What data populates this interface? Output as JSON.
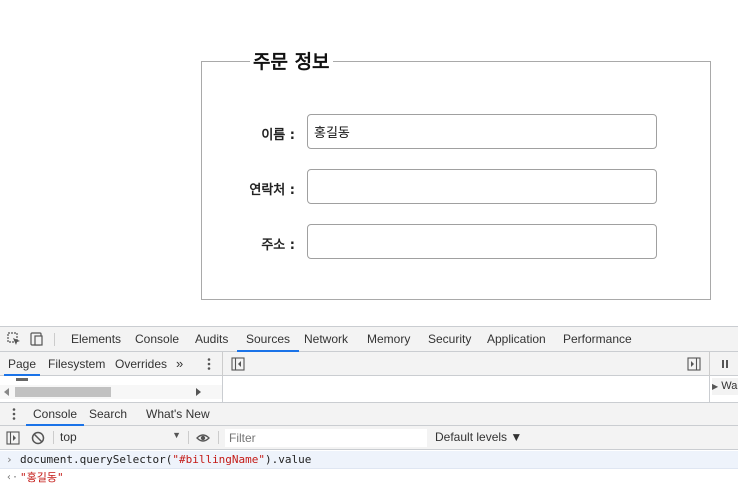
{
  "form": {
    "legend": "주문 정보",
    "fields": [
      {
        "label": "이름 :",
        "value": "홍길동",
        "id": "billingName"
      },
      {
        "label": "연락처 :",
        "value": ""
      },
      {
        "label": "주소 :",
        "value": ""
      }
    ]
  },
  "devtools": {
    "tabs": [
      "Elements",
      "Console",
      "Audits",
      "Sources",
      "Network",
      "Memory",
      "Security",
      "Application",
      "Performance"
    ],
    "active_tab": "Sources",
    "sources_tabs": [
      "Page",
      "Filesystem",
      "Overrides"
    ],
    "sources_more": "»",
    "sources_right_peek": "Wa",
    "drawer_tabs": [
      "Console",
      "Search",
      "What's New"
    ],
    "context": "top",
    "filter_placeholder": "Filter",
    "levels_label": "Default levels ▼",
    "console": {
      "command_prefix": "document.querySelector(",
      "command_arg": "\"#billingName\"",
      "command_suffix": ").value",
      "result": "\"홍길동\""
    }
  },
  "colors": {
    "accent": "#1a73e8",
    "toolbar_bg": "#f3f3f3",
    "string_red": "#c41a16",
    "input_row_bg": "#eef3fb"
  }
}
